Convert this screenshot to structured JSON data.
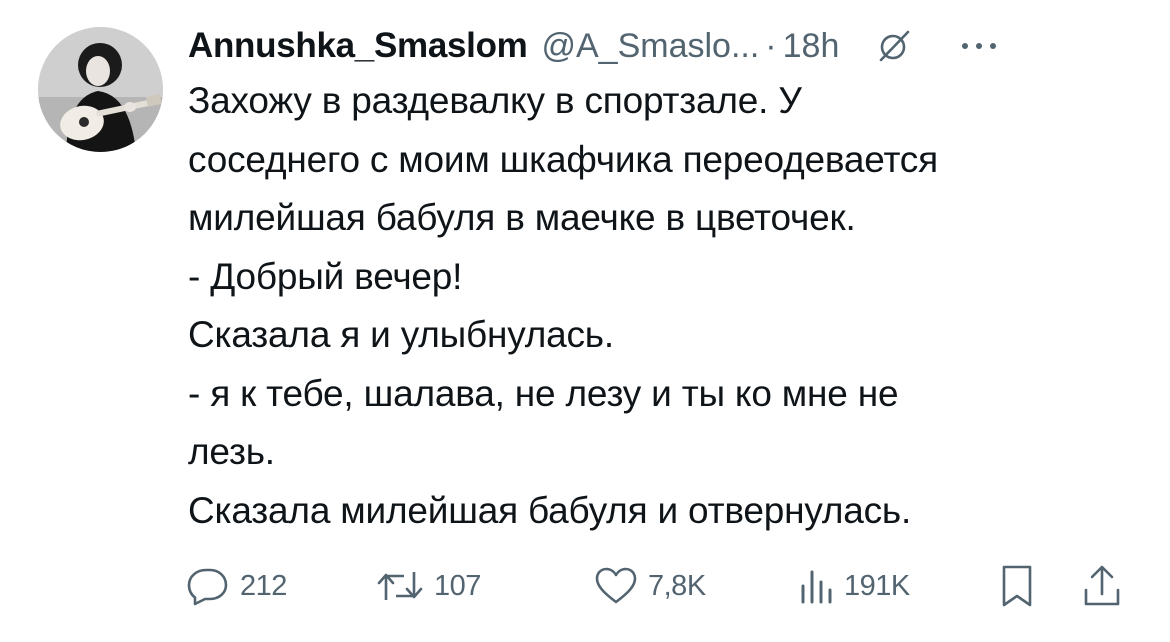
{
  "tweet": {
    "author": {
      "display_name": "Annushka_Smaslom",
      "handle": "@A_Smaslo...",
      "avatar_icon": "avatar-woman-with-guitar"
    },
    "separator": "·",
    "time": "18h",
    "text_lines": [
      "Захожу в раздевалку в спортзале. У",
      "соседнего с моим шкафчика переодевается",
      "милейшая бабуля в маечке в цветочек.",
      "- Добрый вечер!",
      "Сказала я и улыбнулась.",
      "- я к тебе, шалава, не лезу и ты ко мне не",
      "лезь.",
      "Сказала милейшая бабуля и отвернулась."
    ],
    "actions": {
      "reply": {
        "icon": "reply-icon",
        "count": "212"
      },
      "repost": {
        "icon": "repost-icon",
        "count": "107"
      },
      "like": {
        "icon": "heart-icon",
        "count": "7,8K"
      },
      "views": {
        "icon": "analytics-icon",
        "count": "191K"
      },
      "bookmark": {
        "icon": "bookmark-icon"
      },
      "share": {
        "icon": "share-icon"
      }
    },
    "header_icons": {
      "grok": "grok-icon",
      "more": "more-icon"
    },
    "colors": {
      "text_primary": "#0f1419",
      "text_secondary": "#536471",
      "background": "#ffffff"
    }
  }
}
